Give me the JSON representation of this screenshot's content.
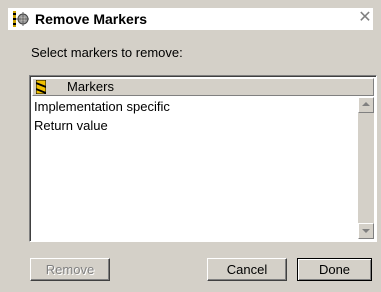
{
  "window": {
    "title": "Remove Markers",
    "close_glyph": "✕"
  },
  "instruction": "Select markers to remove:",
  "list": {
    "header": "Markers",
    "items": [
      "Implementation specific",
      "Return value"
    ]
  },
  "buttons": {
    "remove": "Remove",
    "cancel": "Cancel",
    "done": "Done"
  },
  "icons": {
    "title": "markers-app-icon",
    "header": "marker-tag-icon"
  },
  "colors": {
    "dialog_bg": "#d4d0c8",
    "list_bg": "#ffffff",
    "disabled_text": "#808080",
    "marker_yellow": "#f0c000"
  }
}
